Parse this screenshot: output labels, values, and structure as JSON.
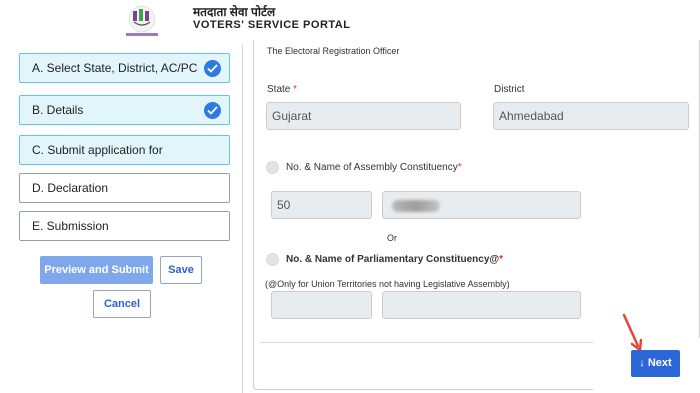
{
  "header": {
    "title_hindi": "मतदाता सेवा पोर्टल",
    "title_english": "VOTERS' SERVICE PORTAL"
  },
  "sidebar": {
    "steps": [
      {
        "label": "A. Select State, District, AC/PC",
        "status": "done"
      },
      {
        "label": "B. Details",
        "status": "done"
      },
      {
        "label": "C. Submit application for",
        "status": "active"
      },
      {
        "label": "D. Declaration",
        "status": "pending"
      },
      {
        "label": "E. Submission",
        "status": "pending"
      }
    ],
    "preview_label": "Preview and Submit",
    "save_label": "Save",
    "cancel_label": "Cancel"
  },
  "form": {
    "ero_text": "The Electoral Registration Officer",
    "state_label": "State",
    "state_value": "Gujarat",
    "district_label": "District",
    "district_value": "Ahmedabad",
    "ac_label": "No. & Name of Assembly Constituency",
    "ac_number": "50",
    "or_text": "Or",
    "pc_label": "No. & Name of Parliamentary Constituency@",
    "pc_note": "(@Only for Union Territories not having Legislative Assembly)",
    "required_mark": "*"
  },
  "footer": {
    "next_label": "Next",
    "next_icon": "arrow-down-icon"
  },
  "colors": {
    "accent": "#2d66d6",
    "step_active_bg": "#e1f5fb",
    "required": "#d9342b",
    "annotation_arrow": "#e2473b"
  }
}
